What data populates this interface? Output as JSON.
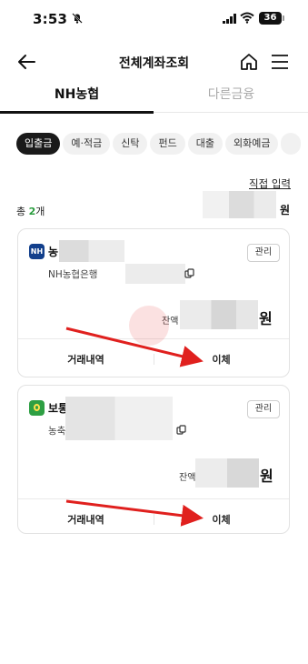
{
  "status_bar": {
    "time": "3:53",
    "battery": "36"
  },
  "nav": {
    "title": "전체계좌조회"
  },
  "tabs": [
    {
      "label": "NH농협",
      "selected": true
    },
    {
      "label": "다른금융",
      "selected": false
    }
  ],
  "chips": [
    {
      "label": "입출금",
      "selected": true
    },
    {
      "label": "예·적금"
    },
    {
      "label": "신탁"
    },
    {
      "label": "펀드"
    },
    {
      "label": "대출"
    },
    {
      "label": "외화예금"
    }
  ],
  "direct_input": "직접 입력",
  "total": {
    "prefix": "총 ",
    "count": "2",
    "suffix": "개",
    "won": "원"
  },
  "accounts": [
    {
      "name": "농",
      "bank_line": "NH농협은행",
      "manage": "관리",
      "balance_label": "잔액",
      "won": "원",
      "history": "거래내역",
      "transfer": "이체",
      "logo_text": "NH"
    },
    {
      "name": "보통",
      "bank_line": "농축",
      "manage": "관리",
      "balance_label": "잔액",
      "won": "원",
      "history": "거래내역",
      "transfer": "이체"
    }
  ],
  "colors": {
    "accent_green": "#2a9d3e",
    "nh_blue": "#123f8c",
    "arrow_red": "#e0201e"
  }
}
